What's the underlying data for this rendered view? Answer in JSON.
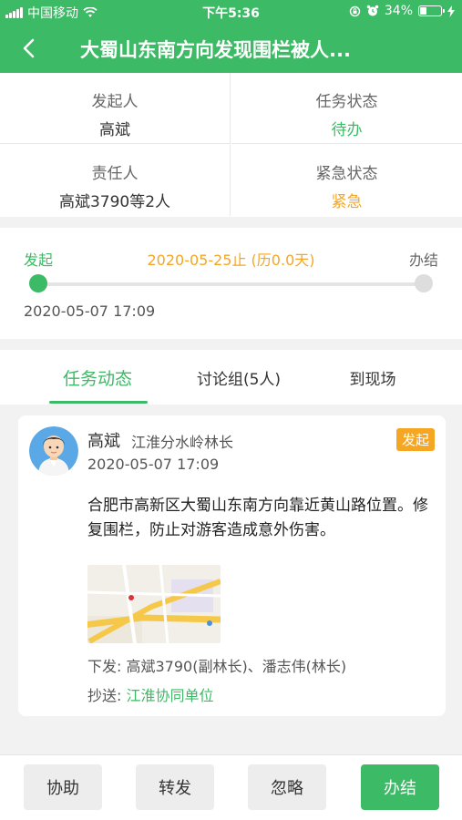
{
  "status_bar": {
    "carrier": "中国移动",
    "time": "下午5:36",
    "battery": "34%",
    "battery_level": 0.34
  },
  "nav": {
    "title": "大蜀山东南方向发现围栏被人..."
  },
  "info": {
    "initiator_label": "发起人",
    "initiator_value": "高斌",
    "task_status_label": "任务状态",
    "task_status_value": "待办",
    "responsible_label": "责任人",
    "responsible_value": "高斌3790等2人",
    "urgency_label": "紧急状态",
    "urgency_value": "紧急"
  },
  "progress": {
    "start_label": "发起",
    "deadline": "2020-05-25止 (历0.0天)",
    "end_label": "办结",
    "start_time": "2020-05-07 17:09",
    "fraction": 0.0
  },
  "tabs": [
    {
      "label": "任务动态"
    },
    {
      "label": "讨论组(5人)"
    },
    {
      "label": "到现场"
    }
  ],
  "feed": {
    "name": "高斌",
    "role": "江淮分水岭林长",
    "badge": "发起",
    "time": "2020-05-07 17:09",
    "content": "合肥市高新区大蜀山东南方向靠近黄山路位置。修复围栏，防止对游客造成意外伤害。",
    "issued": "下发: 高斌3790(副林长)、潘志伟(林长)",
    "cc_label": "抄送: ",
    "cc_value": "江淮协同单位"
  },
  "toolbar": {
    "assist": "协助",
    "forward": "转发",
    "ignore": "忽略",
    "complete": "办结"
  },
  "colors": {
    "primary_green": "#3cba66",
    "urgent_orange": "#f5a623"
  }
}
